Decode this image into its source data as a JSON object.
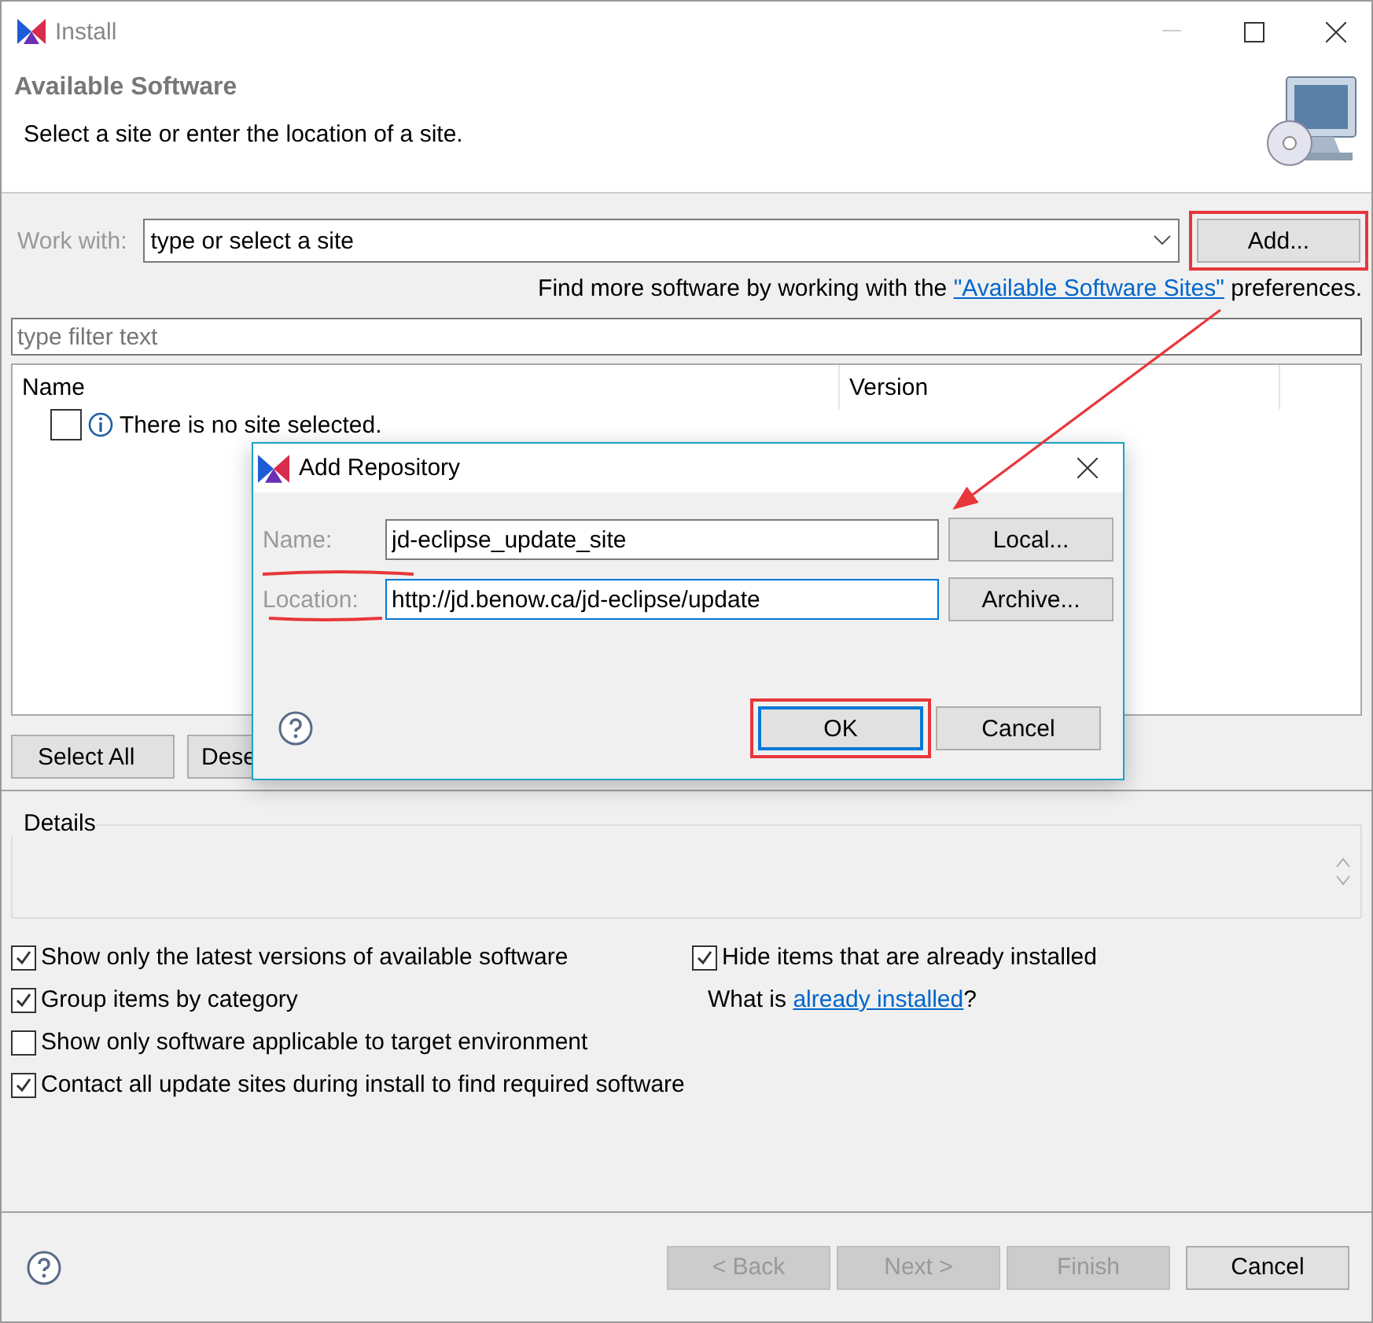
{
  "window": {
    "title": "Install"
  },
  "header": {
    "title": "Available Software",
    "description": "Select a site or enter the location of a site."
  },
  "work_with": {
    "label": "Work with:",
    "placeholder": "type or select a site",
    "add_button": {
      "label": "Add...",
      "highlighted": true
    }
  },
  "more_software": {
    "prefix": "Find more software by working with the ",
    "link": "\"Available Software Sites\"",
    "suffix": " preferences."
  },
  "filter": {
    "placeholder": "type filter text"
  },
  "table": {
    "columns": [
      "Name",
      "Version"
    ],
    "rows": [
      {
        "text": "There is no site selected.",
        "checked": false
      }
    ]
  },
  "selection_buttons": [
    "Select All",
    "Dese"
  ],
  "details": {
    "title": "Details"
  },
  "options": [
    {
      "label": "Show only the latest versions of available software",
      "checked": true
    },
    {
      "label": "Group items by category",
      "checked": true
    },
    {
      "label": "Show only software applicable to target environment",
      "checked": false
    },
    {
      "label": "Contact all update sites during install to find required software",
      "checked": true
    }
  ],
  "hide_installed": {
    "label": "Hide items that are already installed",
    "checked": true
  },
  "installed_link": {
    "prefix": "What is ",
    "link": "already installed",
    "suffix": "?"
  },
  "footer_buttons": [
    {
      "label": "< Back",
      "disabled": true
    },
    {
      "label": "Next >",
      "disabled": true
    },
    {
      "label": "Finish",
      "disabled": true
    },
    {
      "label": "Cancel",
      "disabled": false
    }
  ],
  "dialog": {
    "title": "Add Repository",
    "fields": [
      {
        "label": "Name:",
        "value": "jd-eclipse_update_site",
        "focused": false,
        "button": "Local..."
      },
      {
        "label": "Location:",
        "value": "http://jd.benow.ca/jd-eclipse/update",
        "focused": true,
        "button": "Archive..."
      }
    ],
    "buttons": [
      {
        "label": "OK",
        "default": true,
        "highlighted": true
      },
      {
        "label": "Cancel",
        "default": false,
        "highlighted": false
      }
    ]
  }
}
